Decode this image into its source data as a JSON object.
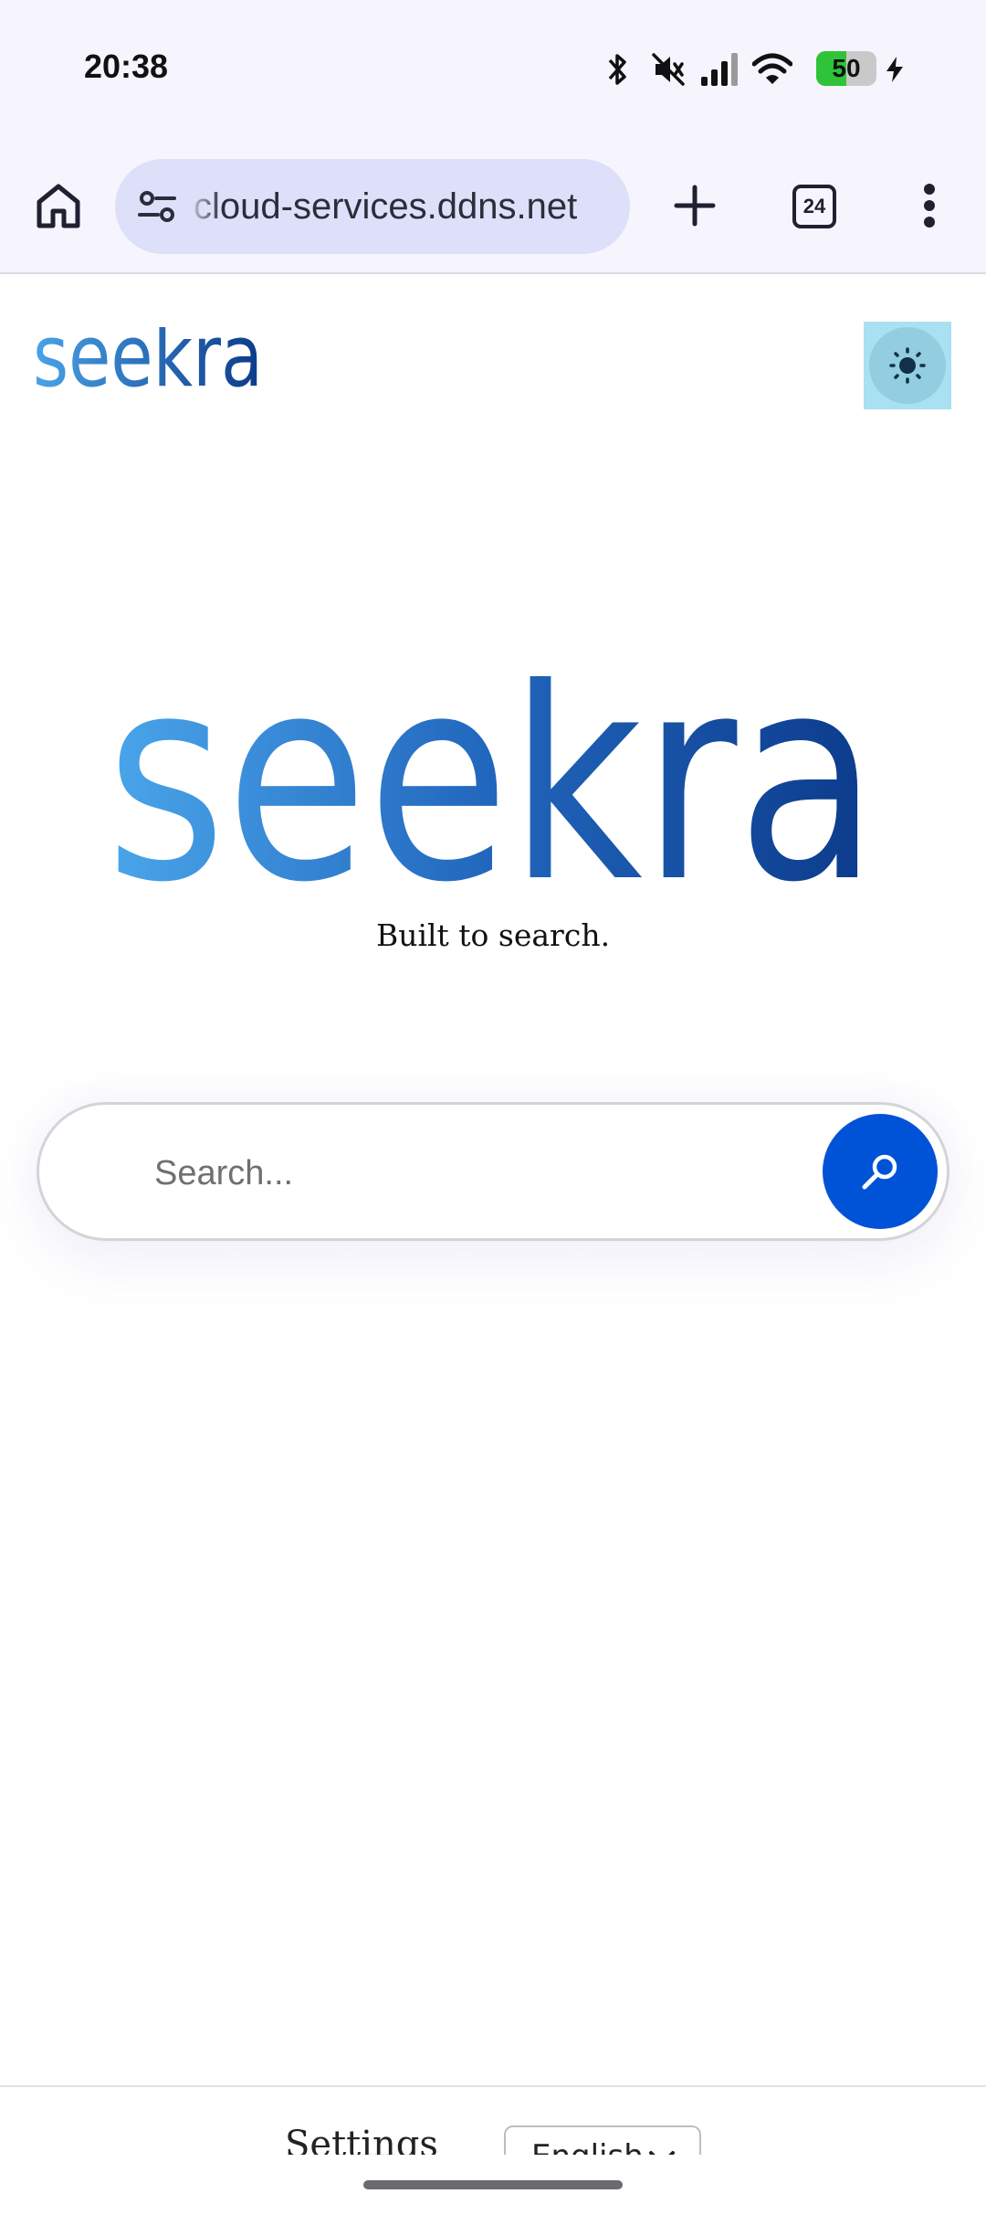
{
  "status_bar": {
    "time": "20:38",
    "battery_level": "50",
    "icons": [
      "bluetooth-icon",
      "mute-icon",
      "signal-icon",
      "wifi-icon",
      "battery-icon",
      "charging-icon"
    ]
  },
  "browser": {
    "url": "cloud-services.ddns.net",
    "tab_count": "24",
    "icons": [
      "home-icon",
      "site-settings-icon",
      "new-tab-icon",
      "tabs-icon",
      "more-icon"
    ]
  },
  "page": {
    "logo_text": "seekra",
    "tagline": "Built to search.",
    "search": {
      "placeholder": "Search..."
    },
    "footer": {
      "settings_label": "Settings",
      "language_selected": "English"
    }
  },
  "colors": {
    "brand_light": "#4aa3e8",
    "brand_dark": "#0c3a8a",
    "search_button": "#0053d6",
    "toggle_bg": "#a9e0f2",
    "browser_bar": "#f6f5fd",
    "url_pill": "#dedff9"
  }
}
